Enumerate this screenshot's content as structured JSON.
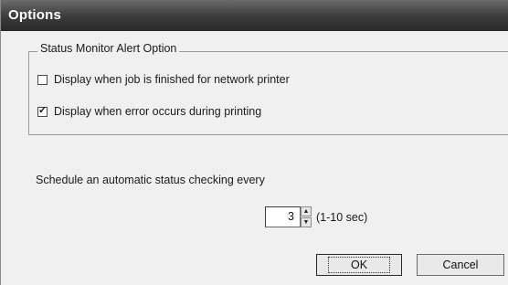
{
  "window": {
    "title": "Options"
  },
  "group": {
    "legend": "Status Monitor Alert Option",
    "options": [
      {
        "label": "Display when job is finished for network printer",
        "checked": false
      },
      {
        "label": "Display when error occurs during printing",
        "checked": true
      }
    ]
  },
  "schedule": {
    "label": "Schedule an automatic status checking every",
    "value": "3",
    "range": "(1-10 sec)"
  },
  "buttons": {
    "ok": "OK",
    "cancel": "Cancel"
  },
  "icons": {
    "up": "spin-up-icon",
    "down": "spin-down-icon",
    "check": "checkmark-icon"
  }
}
